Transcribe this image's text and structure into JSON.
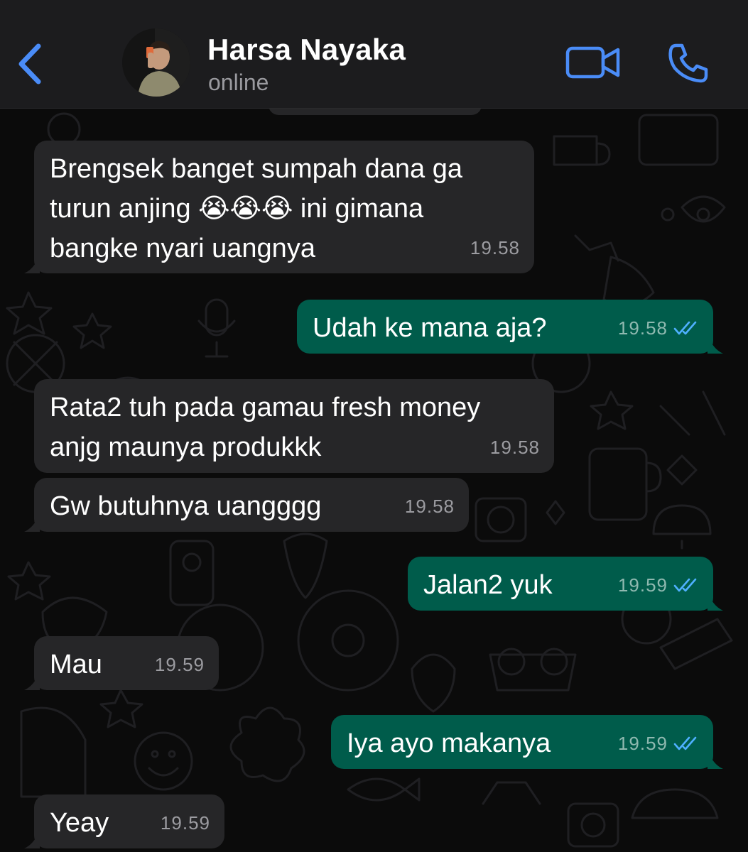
{
  "header": {
    "contact_name": "Harsa Nayaka",
    "status": "online"
  },
  "icons": {
    "back": "chevron-left-icon",
    "video": "video-camera-icon",
    "call": "phone-icon",
    "read": "double-check-icon"
  },
  "colors": {
    "accent": "#4a8cf7",
    "incoming_bubble": "#262628",
    "outgoing_bubble": "#005c4b",
    "read_ticks": "#4fb0ff"
  },
  "messages": [
    {
      "direction": "in",
      "text": "Brengsek banget sumpah dana ga\nturun anjing 😭😭😭 ini gimana\nbangke nyari uangnya",
      "time": "19.58"
    },
    {
      "direction": "out",
      "text": "Udah ke mana aja?",
      "time": "19.58",
      "read": true
    },
    {
      "direction": "in",
      "text": "Rata2 tuh pada gamau fresh money\nanjg maunya produkkk",
      "time": "19.58"
    },
    {
      "direction": "in",
      "text": "Gw butuhnya uangggg",
      "time": "19.58"
    },
    {
      "direction": "out",
      "text": "Jalan2 yuk",
      "time": "19.59",
      "read": true
    },
    {
      "direction": "in",
      "text": "Mau",
      "time": "19.59"
    },
    {
      "direction": "out",
      "text": "Iya ayo makanya",
      "time": "19.59",
      "read": true
    },
    {
      "direction": "in",
      "text": "Yeay",
      "time": "19.59"
    }
  ]
}
